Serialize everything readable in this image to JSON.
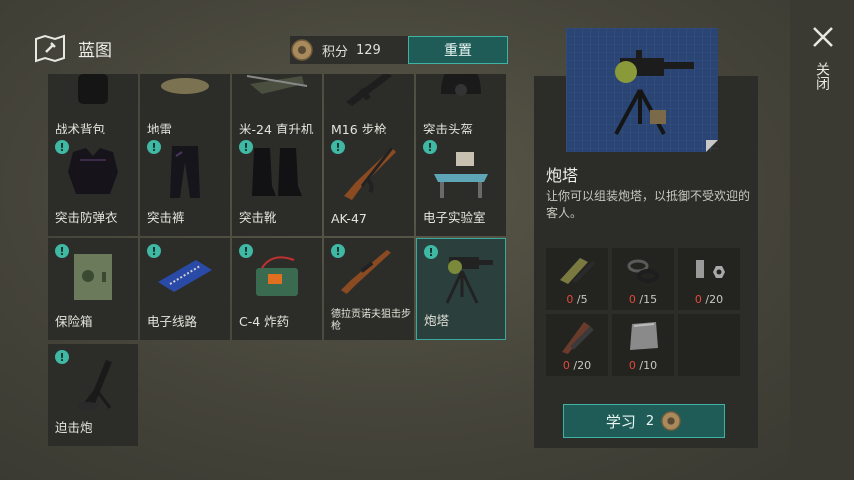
{
  "header": {
    "title": "蓝图",
    "points_label": "积分",
    "points_value": "129",
    "reset_label": "重置"
  },
  "grid": {
    "row0": [
      "战术背包",
      "地雷",
      "米-24 直升机",
      "M16 步枪",
      "突击头盔"
    ],
    "row1": [
      "突击防弹衣",
      "突击裤",
      "突击靴",
      "AK-47",
      "电子实验室"
    ],
    "row2": [
      "保险箱",
      "电子线路",
      "C-4 炸药",
      "德拉贡诺夫狙击步枪",
      "炮塔"
    ],
    "row3": [
      "迫击炮"
    ],
    "badge": "!"
  },
  "detail": {
    "name": "炮塔",
    "description": "让你可以组装炮塔，以抵御不受欢迎的客人。",
    "materials": [
      {
        "icon": "gun-parts-icon",
        "have": "0",
        "need": "/5"
      },
      {
        "icon": "rubber-rings-icon",
        "have": "0",
        "need": "/15"
      },
      {
        "icon": "bolts-nuts-icon",
        "have": "0",
        "need": "/20"
      },
      {
        "icon": "tools-icon",
        "have": "0",
        "need": "/20"
      },
      {
        "icon": "metal-plate-icon",
        "have": "0",
        "need": "/10"
      }
    ],
    "learn_label": "学习",
    "learn_cost": "2"
  },
  "close_label": "关闭",
  "colors": {
    "accent": "#3fb2a4",
    "button_bg": "#1f5c57",
    "missing": "#e04a3a"
  }
}
